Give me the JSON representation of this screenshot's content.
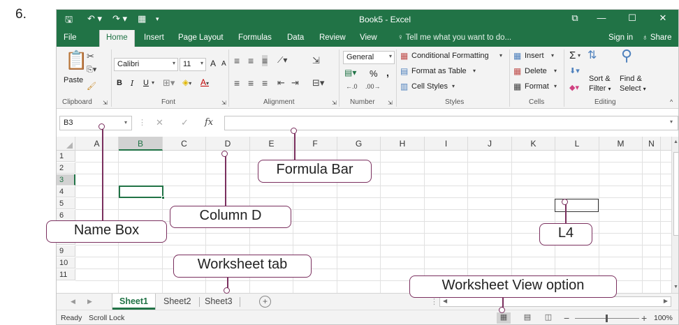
{
  "question_number": "6.",
  "window": {
    "title": "Book5 - Excel",
    "buttons": {
      "restore": "⧉",
      "minimize": "—",
      "maximize": "☐",
      "close": "✕"
    }
  },
  "ribbon_tabs": [
    "File",
    "Home",
    "Insert",
    "Page Layout",
    "Formulas",
    "Data",
    "Review",
    "View"
  ],
  "active_tab": "Home",
  "tell_me": "Tell me what you want to do...",
  "sign_in": "Sign in",
  "share": "Share",
  "ribbon": {
    "clipboard": {
      "paste": "Paste",
      "label": "Clipboard"
    },
    "font": {
      "name": "Calibri",
      "size": "11",
      "bold": "B",
      "italic": "I",
      "underline": "U",
      "grow": "A",
      "shrink": "A",
      "label": "Font"
    },
    "alignment": {
      "label": "Alignment"
    },
    "number": {
      "format": "General",
      "percent": "%",
      "comma": ",",
      "label": "Number"
    },
    "styles": {
      "conditional": "Conditional Formatting",
      "table": "Format as Table",
      "cell_styles": "Cell Styles",
      "label": "Styles"
    },
    "cells": {
      "insert": "Insert",
      "delete": "Delete",
      "format": "Format",
      "label": "Cells"
    },
    "editing": {
      "sum": "Σ",
      "sort": "Sort &",
      "sort2": "Filter",
      "find": "Find &",
      "find2": "Select",
      "label": "Editing"
    }
  },
  "name_box": "B3",
  "columns": [
    "A",
    "B",
    "C",
    "D",
    "E",
    "F",
    "G",
    "H",
    "I",
    "J",
    "K",
    "L",
    "M",
    "N"
  ],
  "rows": [
    "1",
    "2",
    "3",
    "4",
    "5",
    "6",
    "7",
    "8",
    "9",
    "10",
    "11"
  ],
  "selected_cell": {
    "column": "B",
    "row": "3"
  },
  "sheets": [
    "Sheet1",
    "Sheet2",
    "Sheet3"
  ],
  "active_sheet": "Sheet1",
  "status": {
    "ready": "Ready",
    "scroll_lock": "Scroll Lock",
    "zoom": "100%"
  },
  "callouts": {
    "name_box": "Name Box",
    "formula_bar": "Formula Bar",
    "column_d": "Column D",
    "l4": "L4",
    "worksheet_tab": "Worksheet tab",
    "view_option": "Worksheet View option"
  },
  "colors": {
    "accent": "#217346",
    "callout_border": "#7a2f5e"
  }
}
